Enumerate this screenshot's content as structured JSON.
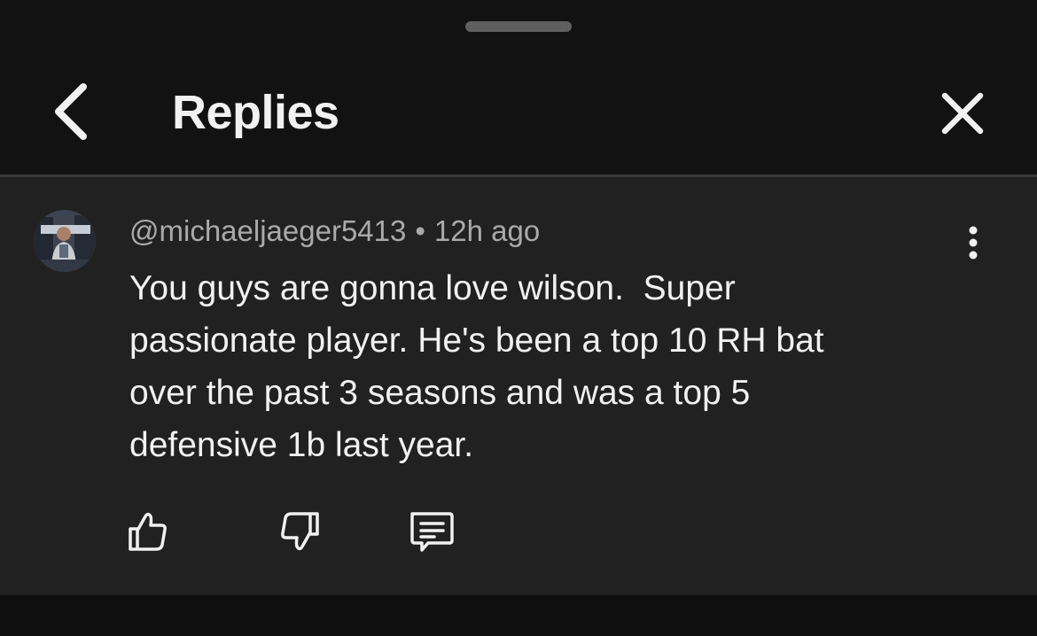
{
  "header": {
    "title": "Replies",
    "back_icon": "chevron-left-icon",
    "close_icon": "close-icon"
  },
  "comment": {
    "author": "@michaeljaeger5413",
    "separator": "•",
    "time_ago": "12h ago",
    "text": "You guys are gonna love wilson.  Super\npassionate player. He's been a top 10 RH bat\nover the past 3 seasons and was a top 5\ndefensive 1b last year.",
    "avatar_icon": "user-avatar",
    "more_icon": "more-vertical-icon"
  },
  "actions": {
    "like_icon": "thumbs-up-icon",
    "dislike_icon": "thumbs-down-icon",
    "reply_icon": "comment-icon"
  },
  "colors": {
    "background": "#0f0f0f",
    "header": "#121212",
    "comment_panel": "#212121",
    "primary_text": "#f1f1f1",
    "secondary_text": "#aaaaaa",
    "divider": "#3a3a3a"
  }
}
